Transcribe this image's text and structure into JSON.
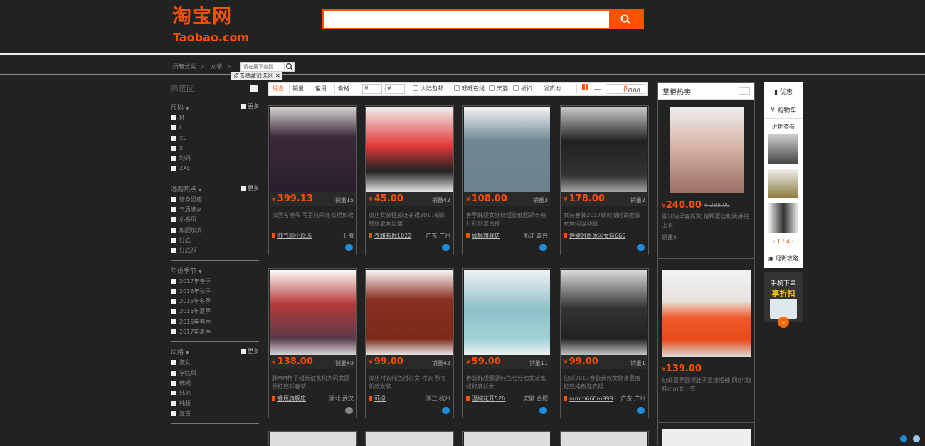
{
  "header": {
    "logo_cn": "淘宝网",
    "logo_en": "Taobao.com",
    "search_value": "",
    "accent_color": "#ff5000"
  },
  "breadcrumb": {
    "items": [
      "所有分类",
      "女装"
    ],
    "inline_search_placeholder": "请在搜下查找",
    "tip": "点击隐藏筛选区"
  },
  "filter": {
    "title": "筛选区",
    "groups": [
      {
        "name": "尺码",
        "more": "更多",
        "items": [
          "M",
          "L",
          "XL",
          "S",
          "均码",
          "2XL"
        ]
      },
      {
        "name": "选购热点",
        "more": "更多",
        "items": [
          "修身显瘦",
          "气质淑女",
          "小香风",
          "加肥加大",
          "打底",
          "打底衫"
        ]
      },
      {
        "name": "年份季节",
        "more": "",
        "items": [
          "2017年春季",
          "2016年秋季",
          "2016年冬季",
          "2016年夏季",
          "2016年春季",
          "2017年夏季"
        ]
      },
      {
        "name": "风格",
        "more": "更多",
        "items": [
          "淑女",
          "学院风",
          "休闲",
          "韩范",
          "韩版",
          "复古"
        ]
      }
    ]
  },
  "sortbar": {
    "items": [
      "综合",
      "销量",
      "信用",
      "价格"
    ],
    "price_from": "¥",
    "price_to": "¥",
    "checks": [
      "大陆包邮",
      "旺旺在线",
      "天猫",
      "折扣"
    ],
    "location": "发货地",
    "page_current": "8",
    "page_total": "/100"
  },
  "products": [
    {
      "price": "399.13",
      "sales": "销量15",
      "title": "法国名模爷 写百花朵连衣裙长裙",
      "shop": "帅气的小珍珠",
      "loc": "上海",
      "ww": "blue"
    },
    {
      "price": "45.00",
      "sales": "销量42",
      "title": "夜店女装性感连衣裙2017新款韩版夏季显瘦",
      "shop": "衣路有你1022",
      "loc": "广东 广州",
      "ww": "blue"
    },
    {
      "price": "108.00",
      "sales": "销量3",
      "title": "春季韩版女针织短款低圆领长袖开衫外套百搭",
      "shop": "顾颜旗舰店",
      "loc": "浙江 嘉兴",
      "ww": "blue"
    },
    {
      "price": "178.00",
      "sales": "销量2",
      "title": "女装春装2017新款潮时尚套装女休闲运动服",
      "shop": "婷婷时尚休闲女装666",
      "loc": "",
      "ww": "blue"
    },
    {
      "price": "138.00",
      "sales": "销量40",
      "title": "胖MM格子粗长袖宽松大码女圆领打底衫春装",
      "shop": "睿辰旗舰店",
      "loc": "湖北 武汉",
      "ww": "gray"
    },
    {
      "price": "99.00",
      "sales": "销量43",
      "title": "夜店衬衣纯色衬衫女 衬衣 秋冬新款女装",
      "shop": "莉缘",
      "loc": "浙江 杭州",
      "ww": "blue"
    },
    {
      "price": "59.00",
      "sales": "销量11",
      "title": "春装韩版圆领纯色七分袖女装宽松打底衫女",
      "shop": "温婉花开520",
      "loc": "安徽 合肥",
      "ww": "blue"
    },
    {
      "price": "99.00",
      "sales": "销量1",
      "title": "包邮2017春装新款女修身显瘦打底纯色连衣裙",
      "shop": "mmm666m999",
      "loc": "广东 广州",
      "ww": "blue"
    }
  ],
  "hot": {
    "title": "掌柜热卖",
    "items": [
      {
        "price": "240.00",
        "old_price": "288.00",
        "title": "欧洲站早春新款 精致蕾丝刺绣拼接上衣",
        "sales": "销量5"
      },
      {
        "price": "139.00",
        "title": "包邮夏季圆领肚子显瘦短袖 网纱t恤胖mm女上衣"
      }
    ]
  },
  "sidebar": {
    "coupon": "优惠",
    "cart": "购物车",
    "recent": "近期查看",
    "page": "1 / 4",
    "guide": "逛街攻略"
  },
  "promo": {
    "line1": "手机下单",
    "line2": "享折扣"
  }
}
